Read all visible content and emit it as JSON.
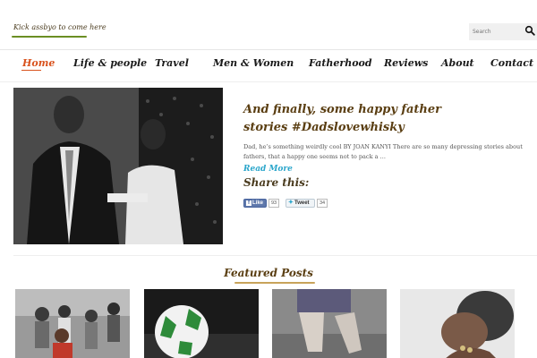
{
  "header": {
    "logo_text": "Kick assbyo to come here",
    "search_placeholder": "Search",
    "accent_color": "#d9531e"
  },
  "nav": {
    "items": [
      {
        "label": "Home",
        "active": true
      },
      {
        "label": "Life & people"
      },
      {
        "label": "Travel"
      },
      {
        "label": "Men & Women"
      },
      {
        "label": "Fatherhood"
      },
      {
        "label": "Reviews"
      },
      {
        "label": "About"
      },
      {
        "label": "Contact"
      }
    ]
  },
  "post": {
    "title": "And finally, some happy father stories #Dadslovewhisky",
    "excerpt": "Dad, he’s something weirdly cool BY JOAN KANYI There are so many depressing stories about fathers, that a happy one seems not to pack a …",
    "read_more": "Read More",
    "share_title": "Share this:",
    "like_label": "Like",
    "like_count": "93",
    "tweet_label": "Tweet",
    "tweet_count": "34"
  },
  "featured": {
    "title": "Featured Posts"
  },
  "icons": {
    "search": "search-icon",
    "facebook": "facebook-icon",
    "twitter": "twitter-icon"
  }
}
